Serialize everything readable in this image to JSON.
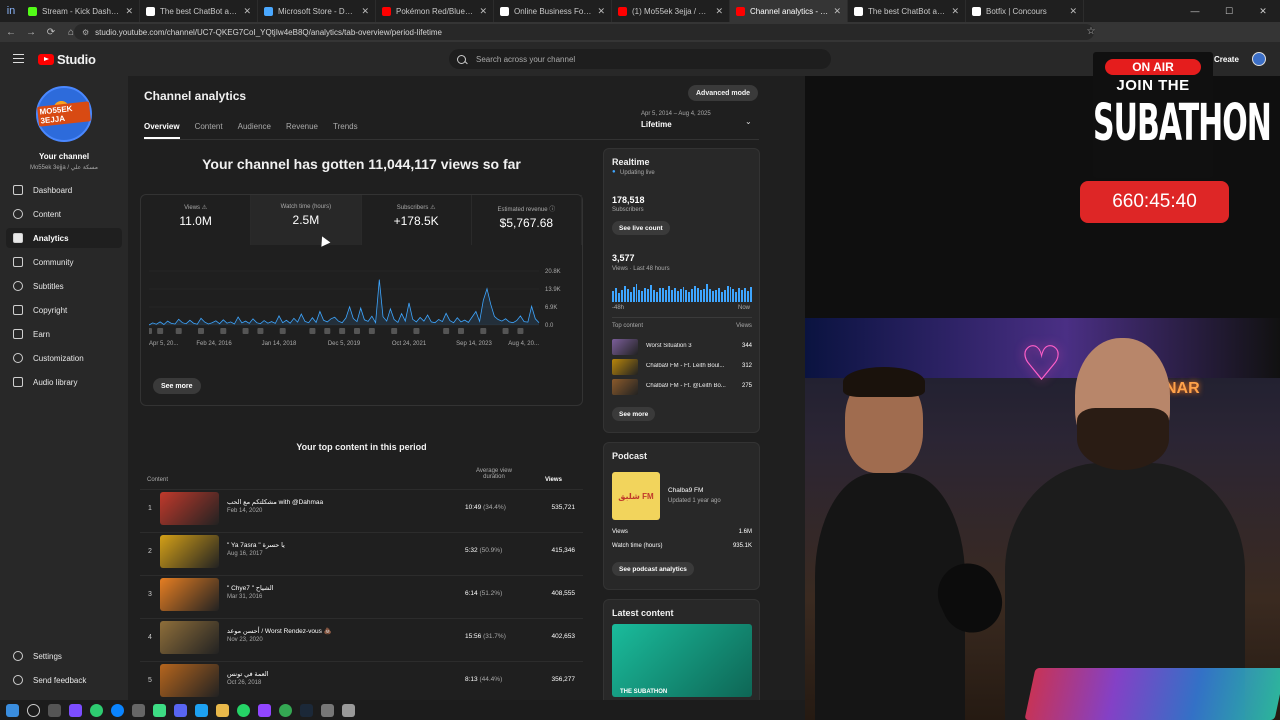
{
  "browser": {
    "tabs": [
      {
        "title": "Stream - Kick Dashboard",
        "color": "#53fc18"
      },
      {
        "title": "The best ChatBot and Widgets",
        "color": "#ffffff"
      },
      {
        "title": "Microsoft Store - Download ap",
        "color": "#4aa8ff"
      },
      {
        "title": "Pokémon Red/Blue | Disco",
        "color": "#ff0000"
      },
      {
        "title": "Online Business For Sale | 5,00",
        "color": "#ffffff"
      },
      {
        "title": "(1) Mo55ek 3ejja / مسكة علي",
        "color": "#ff0000"
      },
      {
        "title": "Channel analytics - YouTube St",
        "color": "#ff0000",
        "active": true
      },
      {
        "title": "The best ChatBot and Widgets",
        "color": "#ffffff"
      },
      {
        "title": "Botfix | Concours",
        "color": "#ffffff"
      }
    ],
    "url": "studio.youtube.com/channel/UC7-QKEG7CoI_YQtjIw4eB8Q/analytics/tab-overview/period-lifetime"
  },
  "header": {
    "logo_text": "Studio",
    "search_placeholder": "Search across your channel",
    "create_label": "Create"
  },
  "sidebar": {
    "avatar_text": "MO55EK 3EJJA",
    "channel_label": "Your channel",
    "channel_handle": "Mo55ek 3ejja / مسكة علي",
    "items": [
      {
        "label": "Dashboard",
        "icon": "dashboard-icon"
      },
      {
        "label": "Content",
        "icon": "content-icon"
      },
      {
        "label": "Analytics",
        "icon": "analytics-icon",
        "active": true
      },
      {
        "label": "Community",
        "icon": "community-icon"
      },
      {
        "label": "Subtitles",
        "icon": "subtitles-icon"
      },
      {
        "label": "Copyright",
        "icon": "copyright-icon"
      },
      {
        "label": "Earn",
        "icon": "earn-icon"
      },
      {
        "label": "Customization",
        "icon": "customization-icon"
      },
      {
        "label": "Audio library",
        "icon": "audio-library-icon"
      }
    ],
    "footer_items": [
      {
        "label": "Settings",
        "icon": "gear-icon"
      },
      {
        "label": "Send feedback",
        "icon": "feedback-icon"
      }
    ]
  },
  "main": {
    "title": "Channel analytics",
    "advanced_label": "Advanced mode",
    "tabs": [
      "Overview",
      "Content",
      "Audience",
      "Revenue",
      "Trends"
    ],
    "date_range": "Apr 5, 2014 – Aug 4, 2025",
    "period": "Lifetime",
    "headline": "Your channel has gotten 11,044,117 views so far",
    "metrics": [
      {
        "label": "Views",
        "value": "11.0M"
      },
      {
        "label": "Watch time (hours)",
        "value": "2.5M"
      },
      {
        "label": "Subscribers",
        "value": "+178.5K"
      },
      {
        "label": "Estimated revenue",
        "value": "$5,767.68"
      }
    ],
    "see_more": "See more",
    "top_content_title": "Your top content in this period",
    "top_content_headers": {
      "content": "Content",
      "avd": "Average view duration",
      "views": "Views"
    },
    "top_content": [
      {
        "rank": "1",
        "title": "مشكلتكم مع الحب with @Dahmaa",
        "date": "Feb 14, 2020",
        "duration": "10:49",
        "pct": "(34.4%)",
        "views": "535,721",
        "color": "#c0392b"
      },
      {
        "rank": "2",
        "title": "\" Ya 7asra \" يا حسرة",
        "date": "Aug 16, 2017",
        "duration": "5:32",
        "pct": "(50.9%)",
        "views": "415,346",
        "color": "#d4a017"
      },
      {
        "rank": "3",
        "title": "\" Chye7 \" الشياح",
        "date": "Mar 31, 2016",
        "duration": "6:14",
        "pct": "(51.2%)",
        "views": "408,555",
        "color": "#e67e22"
      },
      {
        "rank": "4",
        "title": "أحسن موعد / Worst Rendez-vous 💩",
        "date": "Nov 23, 2020",
        "duration": "15:56",
        "pct": "(31.7%)",
        "views": "402,653",
        "color": "#8e6e3a"
      },
      {
        "rank": "5",
        "title": "العمة في تونس",
        "date": "Oct 26, 2018",
        "duration": "8:13",
        "pct": "(44.4%)",
        "views": "356,277",
        "color": "#b5651d"
      }
    ]
  },
  "realtime": {
    "title": "Realtime",
    "status": "Updating live",
    "subs_value": "178,518",
    "subs_label": "Subscribers",
    "live_btn": "See live count",
    "views_value": "3,577",
    "views_label": "Views · Last 48 hours",
    "axis_start": "-48h",
    "axis_end": "Now",
    "top_content_label": "Top content",
    "top_views_label": "Views",
    "bars": [
      0.55,
      0.7,
      0.45,
      0.6,
      0.8,
      0.65,
      0.5,
      0.75,
      0.9,
      0.6,
      0.55,
      0.7,
      0.65,
      0.85,
      0.6,
      0.5,
      0.72,
      0.68,
      0.58,
      0.8,
      0.62,
      0.7,
      0.55,
      0.66,
      0.74,
      0.6,
      0.5,
      0.64,
      0.78,
      0.7,
      0.58,
      0.63,
      0.9,
      0.66,
      0.55,
      0.6,
      0.7,
      0.52,
      0.62,
      0.8,
      0.74,
      0.65,
      0.5,
      0.7,
      0.6,
      0.68,
      0.55,
      0.75
    ],
    "top_items": [
      {
        "title": "Worst Situation 3",
        "views": "344",
        "color": "#7b5e9a"
      },
      {
        "title": "Chalba9 FM - Ft. Leith Boul...",
        "views": "312",
        "color": "#b8860b"
      },
      {
        "title": "Chalba9 FM - Ft. @Leith Bo...",
        "views": "275",
        "color": "#8b5a2b"
      }
    ],
    "see_more": "See more"
  },
  "podcast": {
    "title": "Podcast",
    "name": "Chalba9 FM",
    "updated": "Updated 1 year ago",
    "views_label": "Views",
    "views_value": "1.6M",
    "watch_label": "Watch time (hours)",
    "watch_value": "935.1K",
    "btn": "See podcast analytics",
    "art_text": "شلبق FM"
  },
  "latest": {
    "title": "Latest content",
    "caption": "THE SUBATHON"
  },
  "chart_data": {
    "type": "line",
    "title": "",
    "ylabel": "",
    "xlabel": "",
    "y_ticks": [
      "20.8K",
      "13.9K",
      "6.9K",
      "0.0"
    ],
    "x_ticks": [
      "Apr 5, 20...",
      "Feb 24, 2016",
      "Jan 14, 2018",
      "Dec 5, 2019",
      "Oct 24, 2021",
      "Sep 14, 2023",
      "Aug 4, 20..."
    ],
    "series": [
      {
        "values": [
          0,
          800,
          300,
          1200,
          200,
          1500,
          600,
          400,
          2200,
          900,
          500,
          1800,
          700,
          300,
          2600,
          1100,
          400,
          900,
          1600,
          500,
          2000,
          700,
          1200,
          400,
          3100,
          800,
          1500,
          600,
          2400,
          900,
          500,
          1700,
          700,
          1300,
          600,
          3500,
          900,
          1800,
          700,
          2600,
          1100,
          4200,
          1400,
          900,
          2800,
          1000,
          5200,
          1800,
          1200,
          2400,
          3000,
          1500,
          900,
          2700,
          7000,
          2500,
          1300,
          6500,
          2000,
          1400,
          3400,
          900,
          17500,
          3200,
          1500,
          6200,
          2100,
          1000,
          4400,
          1500,
          8500,
          2200,
          1200,
          2900,
          1500,
          3800,
          1200,
          900,
          2100,
          1300,
          4500,
          1700,
          900,
          2800,
          1200,
          1900,
          1000,
          3100,
          5200,
          1400,
          9500,
          14000,
          8000,
          3300,
          2100,
          1500,
          2400,
          1200,
          900,
          1700,
          3500,
          1300,
          1100,
          7200,
          2400,
          900
        ],
        "color": "#3ea6ff"
      }
    ],
    "ylim": [
      0,
      20800
    ]
  },
  "overlay": {
    "onair": "ON AIR",
    "join": "JOIN THE",
    "subathon": "SUBATHON",
    "timer": "660:45:40"
  }
}
